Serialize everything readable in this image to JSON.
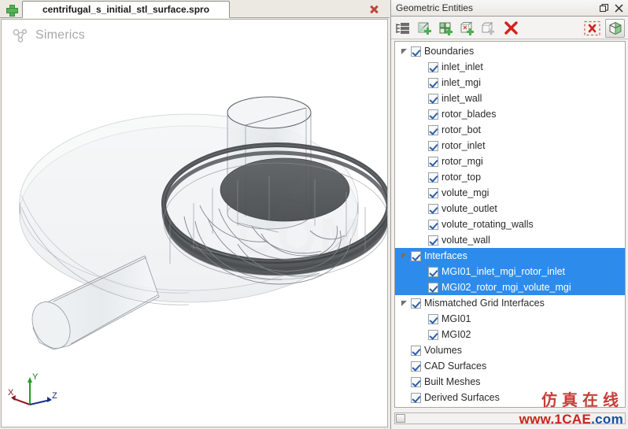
{
  "tab_bar": {
    "add_tab_tooltip": "New",
    "add_icon": "plus-icon",
    "close_icon": "close-icon",
    "tabs": [
      {
        "label": "centrifugal_s_initial_stl_surface.spro",
        "active": true
      }
    ]
  },
  "viewport": {
    "logo_text": "Simerics",
    "logo_icon": "simerics-molecule-icon",
    "watermark_text": "COM",
    "axis": {
      "x_label": "X",
      "y_label": "Y",
      "z_label": "Z",
      "x_color": "#8a1b1b",
      "y_color": "#1f9f1f",
      "z_color": "#1b2f8a"
    },
    "model_description": "centrifugal pump volute with rotor and inlet pipe"
  },
  "panel": {
    "title": "Geometric Entities",
    "float_icon": "float-window-icon",
    "close_icon": "close-icon",
    "toolbar": [
      {
        "name": "list-view-icon",
        "label": "List View"
      },
      {
        "name": "add-boundary-icon",
        "label": "Add Boundary"
      },
      {
        "name": "add-interface-icon",
        "label": "Add Interface"
      },
      {
        "name": "add-mgi-icon",
        "label": "Add Mismatched Grid Interface"
      },
      {
        "name": "add-volume-icon",
        "label": "Add Volume"
      },
      {
        "name": "delete-icon",
        "label": "Delete"
      },
      {
        "name": "deselect-all-icon",
        "label": "Deselect All"
      },
      {
        "name": "show-box-icon",
        "label": "Show Geometry Box"
      }
    ],
    "accent_selection_color": "#2d8ceb"
  },
  "tree": {
    "rows": [
      {
        "label": "Boundaries",
        "indent": 0,
        "twisty": "down",
        "checked": true,
        "selected": false
      },
      {
        "label": "inlet_inlet",
        "indent": 1,
        "twisty": "none",
        "checked": true,
        "selected": false
      },
      {
        "label": "inlet_mgi",
        "indent": 1,
        "twisty": "none",
        "checked": true,
        "selected": false
      },
      {
        "label": "inlet_wall",
        "indent": 1,
        "twisty": "none",
        "checked": true,
        "selected": false
      },
      {
        "label": "rotor_blades",
        "indent": 1,
        "twisty": "none",
        "checked": true,
        "selected": false
      },
      {
        "label": "rotor_bot",
        "indent": 1,
        "twisty": "none",
        "checked": true,
        "selected": false
      },
      {
        "label": "rotor_inlet",
        "indent": 1,
        "twisty": "none",
        "checked": true,
        "selected": false
      },
      {
        "label": "rotor_mgi",
        "indent": 1,
        "twisty": "none",
        "checked": true,
        "selected": false
      },
      {
        "label": "rotor_top",
        "indent": 1,
        "twisty": "none",
        "checked": true,
        "selected": false
      },
      {
        "label": "volute_mgi",
        "indent": 1,
        "twisty": "none",
        "checked": true,
        "selected": false
      },
      {
        "label": "volute_outlet",
        "indent": 1,
        "twisty": "none",
        "checked": true,
        "selected": false
      },
      {
        "label": "volute_rotating_walls",
        "indent": 1,
        "twisty": "none",
        "checked": true,
        "selected": false
      },
      {
        "label": "volute_wall",
        "indent": 1,
        "twisty": "none",
        "checked": true,
        "selected": false
      },
      {
        "label": "Interfaces",
        "indent": 0,
        "twisty": "down",
        "checked": true,
        "selected": true
      },
      {
        "label": "MGI01_inlet_mgi_rotor_inlet",
        "indent": 1,
        "twisty": "none",
        "checked": true,
        "selected": true
      },
      {
        "label": "MGI02_rotor_mgi_volute_mgi",
        "indent": 1,
        "twisty": "none",
        "checked": true,
        "selected": true
      },
      {
        "label": "Mismatched Grid Interfaces",
        "indent": 0,
        "twisty": "down",
        "checked": true,
        "selected": false
      },
      {
        "label": "MGI01",
        "indent": 1,
        "twisty": "right",
        "checked": true,
        "selected": false
      },
      {
        "label": "MGI02",
        "indent": 1,
        "twisty": "right",
        "checked": true,
        "selected": false
      },
      {
        "label": "Volumes",
        "indent": 0,
        "twisty": "right",
        "checked": true,
        "selected": false
      },
      {
        "label": "CAD Surfaces",
        "indent": 0,
        "twisty": "right",
        "checked": true,
        "selected": false
      },
      {
        "label": "Built Meshes",
        "indent": 0,
        "twisty": "right",
        "checked": true,
        "selected": false
      },
      {
        "label": "Derived Surfaces",
        "indent": 0,
        "twisty": "right",
        "checked": true,
        "selected": false
      }
    ]
  },
  "watermark": {
    "cn_text": "仿真在线",
    "url_red": "www.1CAE",
    "url_blue": ".com"
  }
}
